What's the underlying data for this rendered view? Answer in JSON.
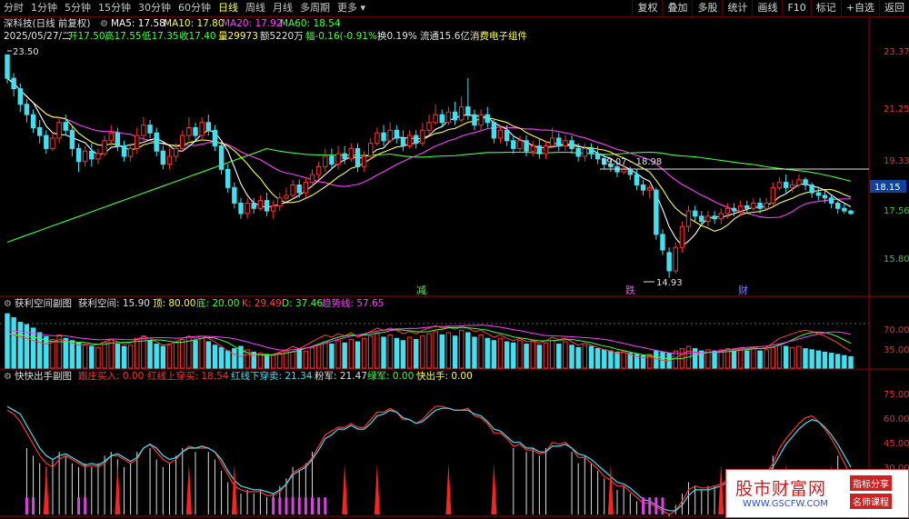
{
  "toolbar": {
    "periods": [
      "分时",
      "1分钟",
      "5分钟",
      "15分钟",
      "30分钟",
      "60分钟",
      "日线",
      "周线",
      "月线",
      "多周期",
      "更多"
    ],
    "active_index": 6,
    "right": [
      "复权",
      "叠加",
      "多股",
      "统计",
      "画线",
      "F10",
      "标记",
      "+自选",
      "返回"
    ]
  },
  "header": {
    "stock": "深科技(日线 前复权)",
    "ma5": "MA5: 17.58",
    "ma10": "MA10: 17.80",
    "ma20": "MA20: 17.92",
    "ma60": "MA60: 18.54",
    "info_prefix": "2025/05/27/二",
    "open": "开17.50",
    "high": "高17.55",
    "low": "低17.35",
    "close": "收17.40",
    "volume": "量29973",
    "amount": "额5220万",
    "change": "幅-0.16(-0.91%)",
    "turnover": "换0.19%",
    "float": "流通15.6亿",
    "sector": "消费电子组件"
  },
  "price_panel": {
    "y_labels": [
      "23.37",
      "21.25",
      "19.33",
      "17.56",
      "15.80"
    ],
    "current_price": "18.15",
    "hline_label": "19.07 - 18.98",
    "high_mark": "23.50",
    "low_mark": "14.93",
    "events": [
      "减",
      "跌",
      "财"
    ]
  },
  "panel2": {
    "title": "获利空间副图",
    "v1": "获利空间: 15.90",
    "v2": "顶: 80.00",
    "v3": "底: 20.00",
    "k": "K: 29.49",
    "d": "D: 37.46",
    "trend": "趋势线: 57.65",
    "y_labels": [
      "70.00",
      "35.00"
    ]
  },
  "panel3": {
    "title": "快快出手副图",
    "v1": "跟庄买入: 0.00",
    "v2": "红线上穿买: 18.54",
    "v3": "红线下穿卖: 21.34",
    "v4": "粉军: 21.47",
    "v5": "绿军: 0.00",
    "v6": "快出手: 0.00",
    "y_labels": [
      "75.00",
      "60.00",
      "45.00",
      "30.00"
    ]
  },
  "watermark": {
    "title": "股市财富网",
    "url": "WWW.GSCFW.COM",
    "tag1": "指标分享",
    "tag2": "名师课程"
  },
  "colors": {
    "up": "#ff3030",
    "down": "#40e0f0",
    "ma5": "#ffffff",
    "ma10": "#ffff40",
    "ma20": "#ff40ff",
    "ma60": "#40ff40",
    "axis": "#a00000"
  },
  "chart_data": {
    "type": "candlestick",
    "y_range": [
      14.5,
      24.0
    ],
    "candles": [
      [
        23.5,
        22.6,
        23.5,
        22.4
      ],
      [
        22.6,
        22.2,
        22.8,
        21.9
      ],
      [
        22.2,
        21.6,
        22.4,
        21.3
      ],
      [
        21.6,
        21.2,
        21.8,
        20.9
      ],
      [
        21.2,
        20.7,
        21.4,
        20.5
      ],
      [
        20.7,
        20.4,
        21.0,
        20.1
      ],
      [
        20.4,
        19.9,
        20.6,
        19.7
      ],
      [
        19.9,
        20.3,
        20.5,
        19.8
      ],
      [
        20.3,
        20.9,
        21.1,
        20.1
      ],
      [
        20.9,
        20.6,
        21.2,
        20.4
      ],
      [
        20.6,
        19.9,
        20.8,
        19.6
      ],
      [
        19.9,
        19.4,
        20.1,
        19.0
      ],
      [
        19.4,
        19.8,
        20.0,
        19.2
      ],
      [
        19.8,
        19.5,
        20.1,
        19.2
      ],
      [
        19.5,
        19.7,
        19.9,
        19.3
      ],
      [
        19.7,
        20.2,
        20.4,
        19.6
      ],
      [
        20.2,
        20.5,
        20.8,
        20.0
      ],
      [
        20.5,
        20.0,
        20.7,
        19.8
      ],
      [
        20.0,
        19.6,
        20.2,
        19.4
      ],
      [
        19.6,
        19.9,
        20.1,
        19.4
      ],
      [
        19.9,
        20.4,
        20.7,
        19.7
      ],
      [
        20.4,
        20.8,
        21.1,
        20.2
      ],
      [
        20.8,
        20.5,
        21.0,
        20.3
      ],
      [
        20.5,
        19.8,
        20.7,
        19.6
      ],
      [
        19.8,
        19.3,
        20.0,
        19.1
      ],
      [
        19.3,
        19.6,
        19.9,
        19.1
      ],
      [
        19.6,
        19.9,
        20.1,
        19.4
      ],
      [
        19.9,
        20.4,
        20.6,
        19.8
      ],
      [
        20.4,
        20.7,
        21.1,
        20.2
      ],
      [
        20.7,
        20.4,
        20.9,
        20.2
      ],
      [
        20.4,
        20.9,
        21.1,
        20.2
      ],
      [
        20.9,
        20.6,
        21.2,
        20.4
      ],
      [
        20.6,
        20.0,
        20.8,
        19.8
      ],
      [
        20.0,
        19.1,
        20.2,
        18.9
      ],
      [
        19.1,
        18.4,
        19.3,
        18.2
      ],
      [
        18.4,
        17.8,
        18.6,
        17.6
      ],
      [
        17.8,
        17.4,
        18.0,
        17.2
      ],
      [
        17.4,
        17.8,
        18.0,
        17.2
      ],
      [
        17.8,
        17.6,
        18.0,
        17.4
      ],
      [
        17.6,
        17.9,
        18.1,
        17.5
      ],
      [
        17.9,
        17.5,
        18.2,
        17.3
      ],
      [
        17.5,
        17.7,
        17.9,
        17.2
      ],
      [
        17.7,
        18.0,
        18.2,
        17.5
      ],
      [
        18.0,
        18.1,
        18.4,
        17.9
      ],
      [
        18.1,
        18.5,
        18.7,
        18.0
      ],
      [
        18.5,
        18.2,
        18.7,
        18.0
      ],
      [
        18.2,
        18.6,
        18.8,
        18.0
      ],
      [
        18.6,
        18.9,
        19.1,
        18.4
      ],
      [
        18.9,
        19.2,
        19.4,
        18.7
      ],
      [
        19.2,
        19.6,
        19.9,
        19.0
      ],
      [
        19.6,
        19.3,
        19.9,
        19.1
      ],
      [
        19.3,
        19.7,
        20.0,
        19.1
      ],
      [
        19.7,
        19.5,
        20.0,
        19.3
      ],
      [
        19.5,
        19.9,
        20.1,
        19.4
      ],
      [
        19.9,
        19.2,
        20.1,
        19.0
      ],
      [
        19.2,
        19.6,
        19.8,
        19.0
      ],
      [
        19.6,
        20.1,
        20.3,
        19.5
      ],
      [
        20.1,
        20.5,
        20.7,
        20.0
      ],
      [
        20.5,
        20.2,
        20.8,
        20.0
      ],
      [
        20.2,
        20.6,
        20.9,
        20.1
      ],
      [
        20.6,
        20.3,
        20.8,
        20.1
      ],
      [
        20.3,
        20.0,
        20.6,
        19.8
      ],
      [
        20.0,
        20.4,
        20.6,
        19.9
      ],
      [
        20.4,
        20.1,
        20.6,
        19.9
      ],
      [
        20.1,
        20.6,
        20.9,
        20.0
      ],
      [
        20.6,
        20.9,
        21.2,
        20.4
      ],
      [
        20.9,
        21.2,
        21.6,
        20.8
      ],
      [
        21.2,
        20.9,
        21.4,
        20.7
      ],
      [
        20.9,
        21.3,
        21.5,
        20.8
      ],
      [
        21.3,
        21.0,
        21.7,
        20.8
      ],
      [
        21.0,
        21.5,
        21.9,
        20.9
      ],
      [
        21.5,
        21.2,
        22.6,
        21.0
      ],
      [
        21.2,
        20.8,
        21.4,
        20.6
      ],
      [
        20.8,
        21.2,
        21.4,
        20.6
      ],
      [
        21.2,
        20.9,
        21.5,
        20.7
      ],
      [
        20.9,
        20.3,
        21.0,
        20.1
      ],
      [
        20.3,
        20.6,
        20.8,
        20.1
      ],
      [
        20.6,
        20.2,
        20.8,
        20.0
      ],
      [
        20.2,
        19.9,
        20.4,
        19.7
      ],
      [
        19.9,
        20.2,
        20.4,
        19.8
      ],
      [
        20.2,
        19.8,
        20.4,
        19.6
      ],
      [
        19.8,
        20.0,
        20.2,
        19.6
      ],
      [
        20.0,
        19.7,
        20.3,
        19.5
      ],
      [
        19.7,
        20.0,
        20.2,
        19.5
      ],
      [
        20.0,
        20.3,
        20.7,
        19.9
      ],
      [
        20.3,
        20.0,
        20.5,
        19.8
      ],
      [
        20.0,
        20.2,
        20.4,
        19.8
      ],
      [
        20.2,
        19.9,
        20.4,
        19.7
      ],
      [
        19.9,
        19.6,
        20.1,
        19.4
      ],
      [
        19.6,
        19.9,
        20.1,
        19.4
      ],
      [
        19.9,
        19.7,
        20.1,
        19.5
      ],
      [
        19.7,
        19.5,
        20.0,
        19.3
      ],
      [
        19.5,
        19.3,
        19.7,
        19.1
      ],
      [
        19.3,
        19.2,
        19.5,
        19.0
      ],
      [
        19.2,
        19.0,
        19.4,
        18.8
      ],
      [
        19.0,
        19.1,
        19.3,
        18.9
      ],
      [
        19.1,
        18.9,
        19.2,
        18.7
      ],
      [
        18.9,
        18.5,
        19.1,
        18.3
      ],
      [
        18.5,
        18.3,
        18.7,
        18.1
      ],
      [
        18.3,
        18.4,
        18.5,
        18.0
      ],
      [
        18.3,
        16.6,
        18.4,
        16.4
      ],
      [
        16.6,
        16.0,
        16.8,
        15.8
      ],
      [
        15.9,
        15.2,
        16.1,
        14.93
      ],
      [
        15.2,
        16.1,
        16.3,
        15.1
      ],
      [
        16.1,
        16.9,
        17.1,
        15.9
      ],
      [
        16.9,
        17.5,
        17.7,
        16.7
      ],
      [
        17.5,
        17.3,
        17.7,
        17.1
      ],
      [
        17.3,
        17.1,
        17.5,
        16.9
      ],
      [
        17.1,
        17.3,
        17.5,
        16.9
      ],
      [
        17.3,
        17.2,
        17.5,
        17.0
      ],
      [
        17.2,
        17.4,
        17.6,
        17.0
      ],
      [
        17.4,
        17.6,
        17.8,
        17.2
      ],
      [
        17.6,
        17.5,
        17.8,
        17.3
      ],
      [
        17.5,
        17.7,
        17.9,
        17.3
      ],
      [
        17.7,
        17.6,
        17.9,
        17.4
      ],
      [
        17.6,
        17.8,
        18.0,
        17.5
      ],
      [
        17.8,
        17.6,
        18.0,
        17.4
      ],
      [
        17.6,
        17.8,
        18.0,
        17.5
      ],
      [
        17.8,
        18.4,
        18.6,
        17.7
      ],
      [
        18.4,
        18.6,
        18.8,
        18.3
      ],
      [
        18.6,
        18.4,
        18.9,
        18.2
      ],
      [
        18.4,
        18.5,
        18.7,
        18.2
      ],
      [
        18.5,
        18.7,
        18.9,
        18.4
      ],
      [
        18.7,
        18.5,
        18.8,
        18.3
      ],
      [
        18.5,
        18.2,
        18.6,
        18.0
      ],
      [
        18.2,
        18.1,
        18.4,
        17.9
      ],
      [
        18.1,
        18.0,
        18.3,
        17.8
      ],
      [
        18.0,
        17.8,
        18.1,
        17.6
      ],
      [
        17.8,
        17.6,
        17.9,
        17.4
      ],
      [
        17.6,
        17.5,
        17.8,
        17.4
      ],
      [
        17.5,
        17.4,
        17.55,
        17.35
      ]
    ],
    "volume": [
      95,
      88,
      80,
      76,
      70,
      62,
      55,
      50,
      58,
      52,
      48,
      44,
      40,
      38,
      36,
      45,
      50,
      42,
      38,
      40,
      52,
      56,
      48,
      42,
      38,
      40,
      44,
      50,
      54,
      48,
      52,
      46,
      40,
      36,
      30,
      34,
      38,
      32,
      28,
      26,
      24,
      22,
      26,
      30,
      28,
      34,
      30,
      36,
      40,
      46,
      42,
      48,
      44,
      50,
      46,
      52,
      56,
      60,
      54,
      58,
      52,
      48,
      54,
      50,
      56,
      60,
      64,
      58,
      62,
      56,
      66,
      62,
      54,
      58,
      52,
      48,
      52,
      46,
      44,
      48,
      42,
      46,
      40,
      44,
      48,
      42,
      46,
      40,
      36,
      40,
      38,
      34,
      32,
      30,
      28,
      30,
      26,
      24,
      22,
      24,
      30,
      28,
      26,
      30,
      34,
      38,
      34,
      30,
      32,
      30,
      32,
      34,
      30,
      32,
      30,
      34,
      30,
      32,
      36,
      40,
      38,
      36,
      38,
      34,
      32,
      30,
      28,
      26,
      24,
      22,
      20
    ],
    "kd_k": [
      60,
      58,
      55,
      52,
      48,
      45,
      42,
      45,
      50,
      48,
      44,
      40,
      42,
      40,
      41,
      46,
      50,
      46,
      42,
      44,
      50,
      55,
      52,
      46,
      40,
      42,
      46,
      52,
      56,
      52,
      56,
      52,
      46,
      38,
      30,
      24,
      20,
      24,
      22,
      26,
      22,
      24,
      28,
      32,
      38,
      34,
      40,
      46,
      52,
      58,
      54,
      60,
      56,
      62,
      54,
      58,
      64,
      70,
      66,
      70,
      66,
      60,
      64,
      60,
      66,
      70,
      74,
      70,
      72,
      68,
      72,
      70,
      64,
      66,
      60,
      54,
      58,
      52,
      48,
      52,
      46,
      48,
      44,
      48,
      54,
      50,
      52,
      46,
      40,
      44,
      40,
      36,
      32,
      30,
      26,
      28,
      24,
      20,
      18,
      20,
      16,
      14,
      12,
      18,
      24,
      30,
      28,
      26,
      28,
      28,
      30,
      32,
      32,
      34,
      34,
      36,
      34,
      36,
      44,
      52,
      56,
      60,
      64,
      66,
      64,
      60,
      56,
      50,
      44,
      36,
      29.49
    ],
    "sub3": {
      "white_line": [
        60,
        58,
        56,
        50,
        46,
        42,
        40,
        44,
        48,
        46,
        42,
        40,
        42,
        40,
        42,
        46,
        48,
        44,
        40,
        42,
        48,
        52,
        50,
        44,
        40,
        42,
        46,
        50,
        52,
        48,
        52,
        48,
        44,
        38,
        32,
        28,
        26,
        28,
        26,
        28,
        24,
        26,
        30,
        34,
        40,
        38,
        42,
        48,
        54,
        60,
        58,
        64,
        60,
        66,
        58,
        62,
        68,
        72,
        68,
        72,
        68,
        62,
        66,
        62,
        68,
        72,
        74,
        70,
        72,
        68,
        72,
        70,
        64,
        66,
        60,
        56,
        60,
        54,
        50,
        54,
        48,
        50,
        46,
        50,
        56,
        52,
        54,
        48,
        42,
        46,
        42,
        38,
        34,
        32,
        28,
        30,
        26,
        22,
        20,
        22,
        18,
        16,
        14,
        20,
        26,
        32,
        30,
        28,
        30,
        30,
        32,
        34,
        34,
        36,
        36,
        38,
        36,
        38,
        46,
        54,
        58,
        62,
        66,
        68,
        66,
        62,
        58,
        52,
        46,
        38,
        30
      ],
      "red_line": [
        70,
        68,
        64,
        58,
        52,
        46,
        42,
        40,
        44,
        46,
        44,
        42,
        40,
        41,
        40,
        42,
        46,
        46,
        44,
        42,
        44,
        50,
        52,
        48,
        44,
        42,
        44,
        48,
        51,
        50,
        50,
        50,
        48,
        42,
        36,
        30,
        28,
        27,
        27,
        27,
        25,
        25,
        27,
        31,
        37,
        39,
        41,
        45,
        51,
        57,
        59,
        61,
        61,
        63,
        61,
        61,
        65,
        69,
        69,
        71,
        69,
        65,
        65,
        63,
        65,
        69,
        72,
        72,
        71,
        70,
        70,
        71,
        67,
        66,
        63,
        58,
        58,
        55,
        51,
        52,
        49,
        49,
        47,
        48,
        53,
        52,
        53,
        50,
        45,
        45,
        42,
        39,
        35,
        33,
        30,
        30,
        27,
        24,
        21,
        21,
        19,
        17,
        15,
        17,
        22,
        28,
        30,
        29,
        29,
        30,
        31,
        33,
        34,
        35,
        36,
        37,
        37,
        37,
        42,
        50,
        55,
        59,
        63,
        66,
        67,
        64,
        60,
        55,
        49,
        42,
        35
      ],
      "cyan_line": [
        72,
        70,
        68,
        62,
        56,
        50,
        46,
        44,
        46,
        47,
        45,
        43,
        41,
        42,
        41,
        43,
        46,
        47,
        45,
        43,
        45,
        50,
        52,
        50,
        46,
        44,
        45,
        48,
        50,
        50,
        51,
        50,
        48,
        44,
        38,
        33,
        30,
        29,
        28,
        28,
        27,
        26,
        28,
        31,
        36,
        38,
        40,
        44,
        49,
        55,
        57,
        60,
        60,
        62,
        60,
        60,
        63,
        67,
        68,
        70,
        69,
        66,
        65,
        63,
        64,
        67,
        70,
        71,
        71,
        70,
        70,
        70,
        68,
        67,
        64,
        60,
        59,
        56,
        53,
        53,
        50,
        50,
        48,
        48,
        51,
        51,
        52,
        50,
        47,
        46,
        44,
        41,
        38,
        35,
        32,
        31,
        29,
        26,
        23,
        22,
        20,
        18,
        17,
        17,
        20,
        25,
        28,
        28,
        28,
        29,
        30,
        32,
        33,
        34,
        35,
        36,
        36,
        37,
        40,
        46,
        52,
        56,
        60,
        63,
        65,
        64,
        61,
        57,
        52,
        46,
        40
      ]
    }
  }
}
